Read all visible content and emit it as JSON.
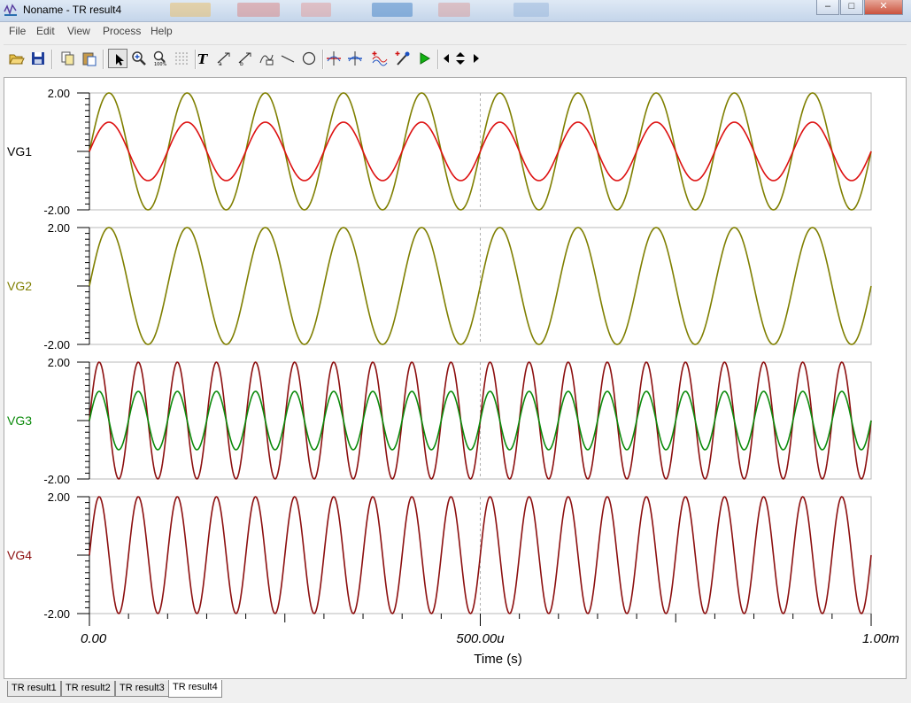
{
  "window": {
    "title": "Noname - TR result4",
    "minimize": "–",
    "maximize": "□",
    "close": "✕"
  },
  "menu": [
    "File",
    "Edit",
    "View",
    "Process",
    "Help"
  ],
  "toolbar": {
    "buttons": [
      {
        "name": "open-icon"
      },
      {
        "name": "save-icon"
      },
      {
        "name": "copy-icon"
      },
      {
        "name": "paste-icon"
      },
      {
        "name": "pointer-icon",
        "pressed": true
      },
      {
        "name": "zoom-in-icon"
      },
      {
        "name": "zoom-100-icon"
      },
      {
        "name": "grid-icon"
      },
      {
        "name": "text-icon"
      },
      {
        "name": "label-a-icon"
      },
      {
        "name": "label-b-icon"
      },
      {
        "name": "curve-label-icon"
      },
      {
        "name": "line-icon"
      },
      {
        "name": "circle-icon"
      },
      {
        "name": "cursor-a-icon"
      },
      {
        "name": "cursor-b-icon"
      },
      {
        "name": "add-curve-icon"
      },
      {
        "name": "probe-icon"
      },
      {
        "name": "run-icon"
      },
      {
        "name": "arrow-left-icon"
      },
      {
        "name": "arrow-updown-icon"
      },
      {
        "name": "arrow-right-icon"
      }
    ]
  },
  "plot": {
    "x_axis": {
      "label": "Time (s)",
      "ticks": [
        "0.00",
        "500.00u",
        "1.00m"
      ],
      "range": [
        0,
        0.001
      ]
    },
    "marker_x": 0.0005,
    "colors": {
      "olive": "#7f7f00",
      "red": "#dd1111",
      "green": "#0b8a0b",
      "maroon": "#8c0f0f",
      "axis": "#000000",
      "label_dark": "#000000"
    },
    "panels": [
      {
        "label": "VG1",
        "label_color": "#000000",
        "y_top": "2.00",
        "y_bottom": "-2.00",
        "ylim": [
          -2,
          2
        ],
        "series": [
          {
            "color": "#7f7f00",
            "amplitude": 2.0,
            "frequency_hz": 10000,
            "phase_deg": 0
          },
          {
            "color": "#dd1111",
            "amplitude": 1.0,
            "frequency_hz": 10000,
            "phase_deg": 0
          }
        ]
      },
      {
        "label": "VG2",
        "label_color": "#7f7f00",
        "y_top": "2.00",
        "y_bottom": "-2.00",
        "ylim": [
          -2,
          2
        ],
        "series": [
          {
            "color": "#7f7f00",
            "amplitude": 2.0,
            "frequency_hz": 10000,
            "phase_deg": 0
          }
        ]
      },
      {
        "label": "VG3",
        "label_color": "#0b8a0b",
        "y_top": "2.00",
        "y_bottom": "-2.00",
        "ylim": [
          -2,
          2
        ],
        "series": [
          {
            "color": "#8c0f0f",
            "amplitude": 2.0,
            "frequency_hz": 20000,
            "phase_deg": 0
          },
          {
            "color": "#0b8a0b",
            "amplitude": 1.0,
            "frequency_hz": 20000,
            "phase_deg": 0
          }
        ]
      },
      {
        "label": "VG4",
        "label_color": "#8c0f0f",
        "y_top": "2.00",
        "y_bottom": "-2.00",
        "ylim": [
          -2,
          2
        ],
        "series": [
          {
            "color": "#8c0f0f",
            "amplitude": 2.0,
            "frequency_hz": 20000,
            "phase_deg": 0
          }
        ]
      }
    ]
  },
  "tabs": [
    {
      "label": "TR result1",
      "active": false
    },
    {
      "label": "TR result2",
      "active": false
    },
    {
      "label": "TR result3",
      "active": false
    },
    {
      "label": "TR result4",
      "active": true
    }
  ]
}
